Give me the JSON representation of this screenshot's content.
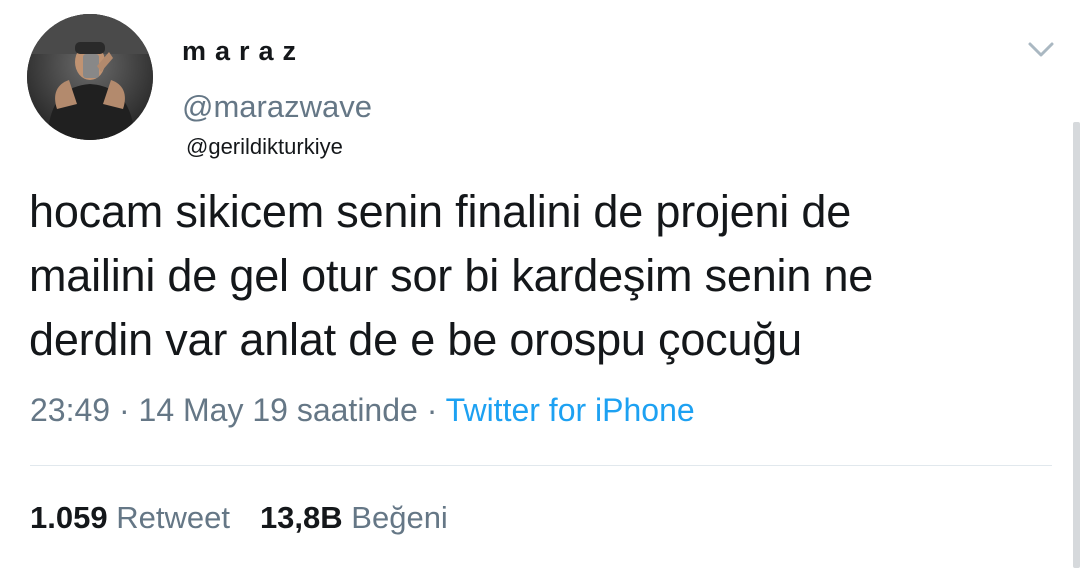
{
  "user": {
    "display_name": "maraz",
    "handle": "@marazwave",
    "avatar_icon": "avatar-photo"
  },
  "reply_to": "@gerildikturkiye",
  "tweet": {
    "lines": [
      "hocam sikicem senin finalini de projeni de",
      "mailini de gel otur sor bi kardeşim senin ne",
      "derdin var anlat de e be orospu çocuğu"
    ],
    "time": "23:49",
    "date": "14 May 19 saatinde",
    "separator": " · ",
    "source": "Twitter for iPhone"
  },
  "stats": {
    "retweet_count": "1.059",
    "retweet_label": "Retweet",
    "like_count": "13,8B",
    "like_label": "Beğeni"
  },
  "colors": {
    "text": "#14171a",
    "secondary": "#657786",
    "link": "#1da1f2",
    "divider": "#e1e8ed"
  },
  "icons": {
    "menu": "chevron-down-icon"
  }
}
